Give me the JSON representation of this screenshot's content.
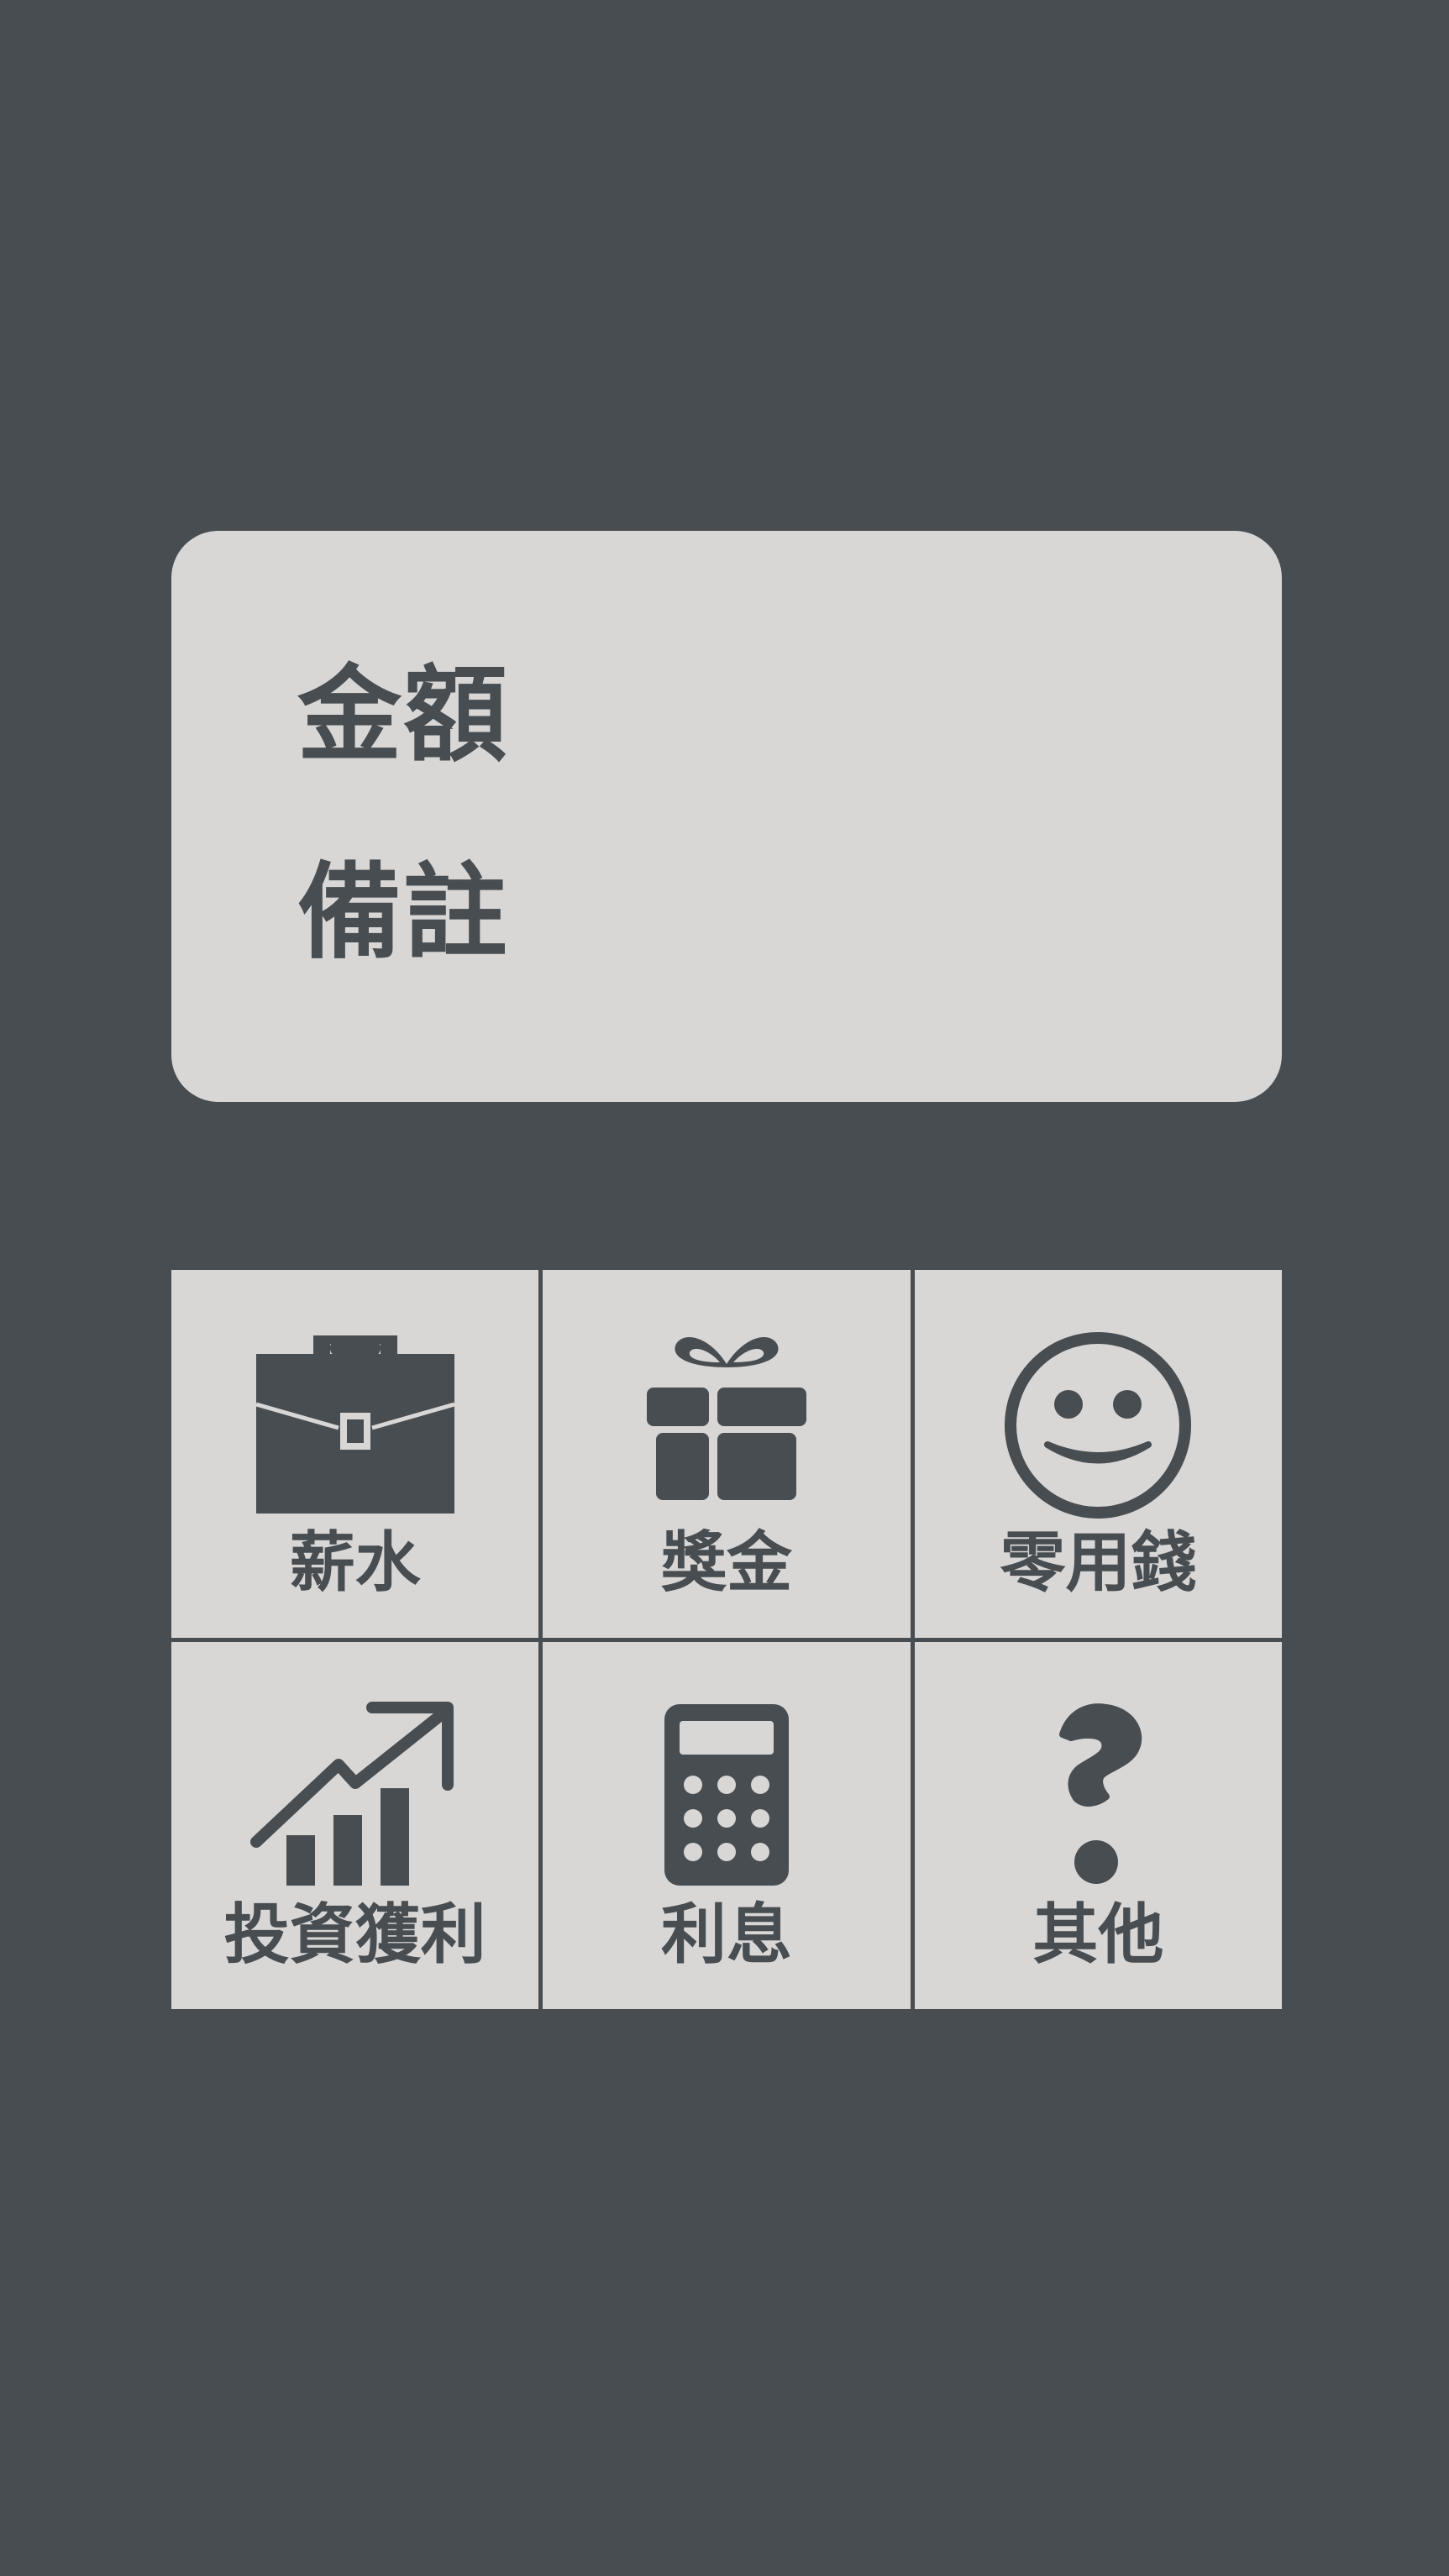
{
  "form": {
    "amount_label": "金額",
    "amount_value": "",
    "note_label": "備註",
    "note_value": ""
  },
  "categories": [
    {
      "label": "薪水",
      "icon": "briefcase-icon"
    },
    {
      "label": "獎金",
      "icon": "gift-icon"
    },
    {
      "label": "零用錢",
      "icon": "smiley-icon"
    },
    {
      "label": "投資獲利",
      "icon": "growth-chart-icon"
    },
    {
      "label": "利息",
      "icon": "calculator-icon"
    },
    {
      "label": "其他",
      "icon": "question-mark-icon"
    }
  ],
  "colors": {
    "background": "#474d50",
    "card": "#d9d6d6",
    "text": "#474d50"
  }
}
